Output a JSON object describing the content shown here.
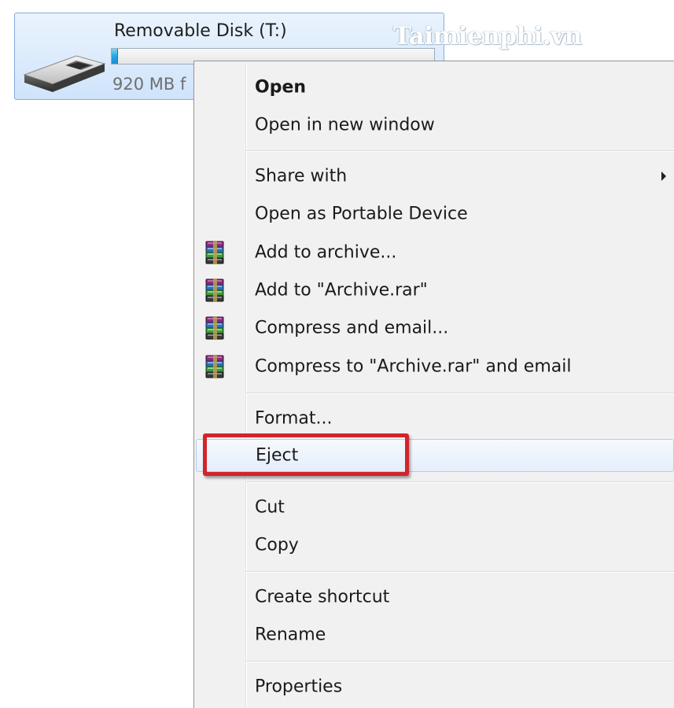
{
  "drive": {
    "name": "Removable Disk (T:)",
    "free_text": "920 MB f",
    "icon": "usb-drive-icon",
    "used_fraction": 0.02
  },
  "watermark": "Taimienphi.vn",
  "context_menu": {
    "items": [
      {
        "label": "Open",
        "bold": true
      },
      {
        "label": "Open in new window"
      },
      {
        "label": "Share with",
        "submenu": true
      },
      {
        "label": "Open as Portable Device"
      },
      {
        "label": "Add to archive...",
        "icon": "winrar-icon"
      },
      {
        "label": "Add to \"Archive.rar\"",
        "icon": "winrar-icon"
      },
      {
        "label": "Compress and email...",
        "icon": "winrar-icon"
      },
      {
        "label": "Compress to \"Archive.rar\" and email",
        "icon": "winrar-icon"
      },
      {
        "label": "Format..."
      },
      {
        "label": "Eject",
        "highlighted": true
      },
      {
        "label": "Cut"
      },
      {
        "label": "Copy"
      },
      {
        "label": "Create shortcut"
      },
      {
        "label": "Rename"
      },
      {
        "label": "Properties"
      }
    ]
  },
  "colors": {
    "highlight_box": "#d3242a",
    "tile_border": "#84acdd",
    "capacity_fill": "#27a6e2"
  }
}
